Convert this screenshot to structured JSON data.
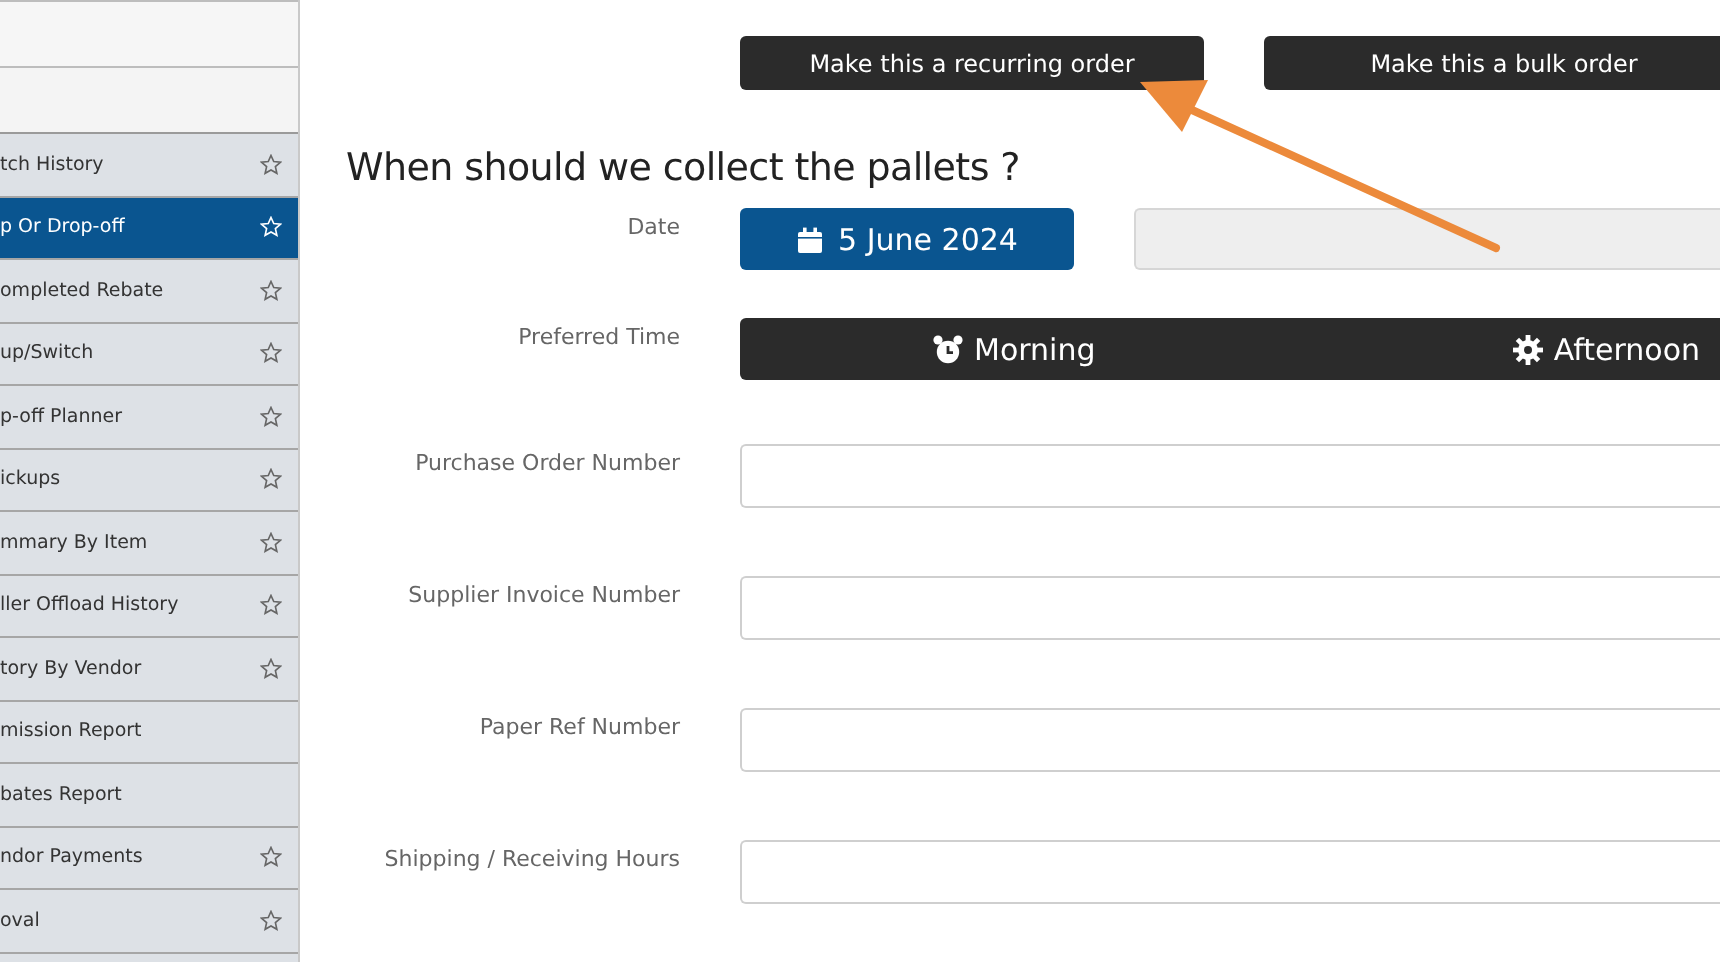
{
  "sidebar": {
    "items": [
      {
        "label": "tch History",
        "starred": true,
        "selected": false
      },
      {
        "label": "p Or Drop-off",
        "starred": true,
        "selected": true
      },
      {
        "label": "ompleted Rebate",
        "starred": true,
        "selected": false
      },
      {
        "label": "up/Switch",
        "starred": true,
        "selected": false
      },
      {
        "label": "p-off Planner",
        "starred": true,
        "selected": false
      },
      {
        "label": "ickups",
        "starred": true,
        "selected": false
      },
      {
        "label": "mmary By Item",
        "starred": true,
        "selected": false
      },
      {
        "label": "ller Offload History",
        "starred": true,
        "selected": false
      },
      {
        "label": "tory By Vendor",
        "starred": true,
        "selected": false
      },
      {
        "label": "mission Report",
        "starred": false,
        "selected": false
      },
      {
        "label": "bates Report",
        "starred": false,
        "selected": false
      },
      {
        "label": "ndor Payments",
        "starred": true,
        "selected": false
      },
      {
        "label": "oval",
        "starred": true,
        "selected": false
      }
    ]
  },
  "action_buttons": [
    "Make this a recurring order",
    "Make this a bulk order"
  ],
  "heading": "When should we collect the pallets ?",
  "form": [
    {
      "kind": "date",
      "label": "Date",
      "value": "5 June 2024"
    },
    {
      "kind": "toggle",
      "label": "Preferred Time",
      "options": [
        "Morning",
        "Afternoon"
      ]
    },
    {
      "kind": "text",
      "label": "Purchase Order Number"
    },
    {
      "kind": "text",
      "label": "Supplier Invoice Number"
    },
    {
      "kind": "text",
      "label": "Paper Ref Number"
    },
    {
      "kind": "text",
      "label": "Shipping / Receiving Hours"
    }
  ]
}
